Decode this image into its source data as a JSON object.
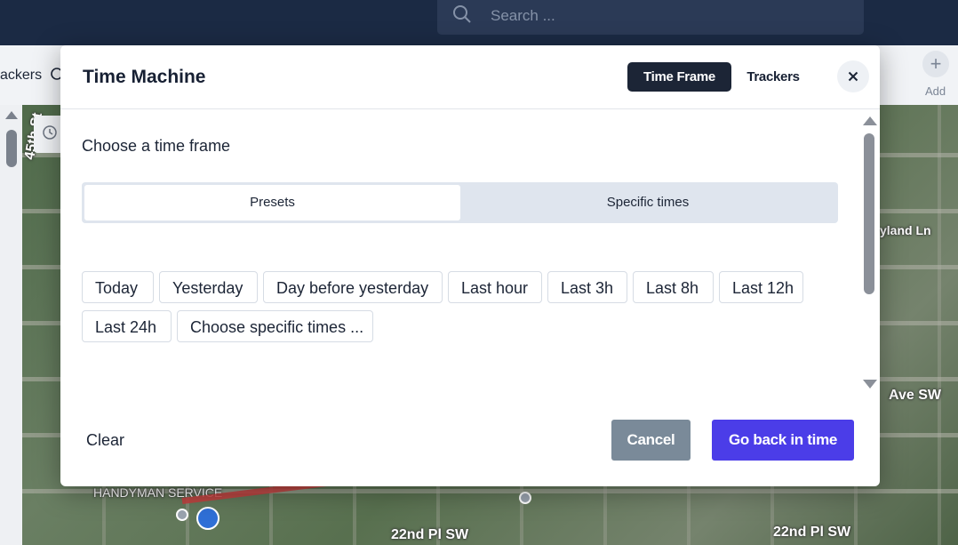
{
  "app": {
    "search": {
      "placeholder": "Search ..."
    },
    "tabs": {
      "trackers_partial": "ackers"
    },
    "add_button": {
      "label": "Add",
      "symbol": "+"
    }
  },
  "map": {
    "streets": [
      "45th St",
      "22nd Pl SW",
      "22nd Pl SW",
      "Ave SW",
      "yland Ln"
    ],
    "poi": "HANDYMAN SERVICE"
  },
  "modal": {
    "title": "Time Machine",
    "tabs": [
      {
        "label": "Time Frame",
        "active": true
      },
      {
        "label": "Trackers",
        "active": false
      }
    ],
    "close_icon": "close-icon",
    "section_label": "Choose a time frame",
    "mode_toggle": {
      "options": [
        "Presets",
        "Specific times"
      ],
      "selected": "Presets"
    },
    "presets": [
      "Today",
      "Yesterday",
      "Day before yesterday",
      "Last hour",
      "Last 3h",
      "Last 8h",
      "Last 12h",
      "Last 24h",
      "Choose specific times ..."
    ],
    "footer": {
      "clear_label": "Clear",
      "cancel_label": "Cancel",
      "submit_label": "Go back in time"
    }
  },
  "colors": {
    "topbar": "#1b2a44",
    "active_tab": "#1c2536",
    "primary_button": "#4b3de8",
    "cancel_button": "#7a8a99",
    "route": "#c73d3d"
  }
}
